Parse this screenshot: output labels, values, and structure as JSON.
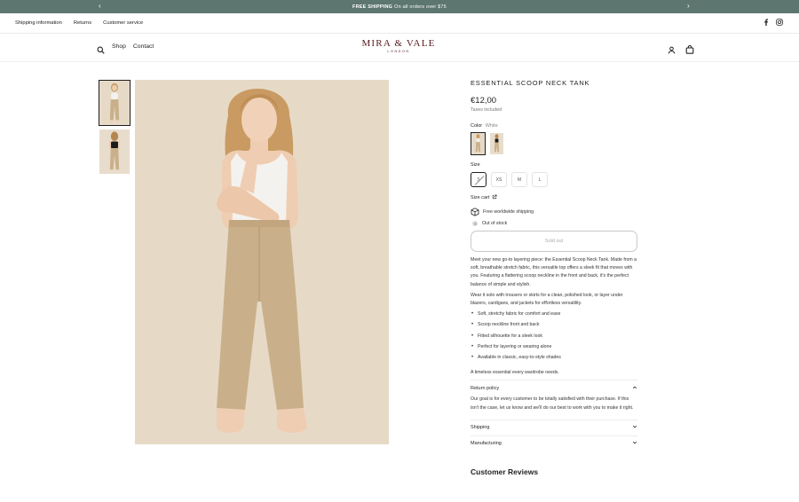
{
  "announcement": {
    "strong": "FREE SHIPPING",
    "text": "On all orders over $75",
    "prev_icon": "chevron-left-icon",
    "next_icon": "chevron-right-icon"
  },
  "utility_links": [
    "Shipping information",
    "Returns",
    "Customer service"
  ],
  "social_icons": [
    "facebook-icon",
    "instagram-icon"
  ],
  "nav": {
    "search_icon": "search-icon",
    "links": [
      "Shop",
      "Contact"
    ],
    "account_icon": "account-icon",
    "cart_icon": "bag-icon"
  },
  "brand": {
    "name": "MIRA & VALE",
    "sub": "LONDON",
    "color": "#5a2024"
  },
  "colors": {
    "announcement_bg": "#5d7670",
    "photo_bg": "#e6dac7",
    "pants": "#c9b08a",
    "top": "#f4f2ee"
  },
  "product": {
    "title": "ESSENTIAL SCOOP NECK TANK",
    "price": "€12,00",
    "tax_note": "Taxes included",
    "color_label": "Color",
    "color_value": "White",
    "size_label": "Size",
    "sizes": [
      "S",
      "XS",
      "M",
      "L"
    ],
    "selected_size": "S",
    "size_chart": "Size cart",
    "shipping_feature": "Free worldwide shipping",
    "stock_status": "Out of stock",
    "button": "Sold out",
    "description_p1": "Meet your new go-to layering piece: the Essential Scoop Neck Tank. Made from a soft, breathable stretch fabric, this versatile top offers a sleek fit that moves with you. Featuring a flattering scoop neckline in the front and back, it's the perfect balance of simple and stylish.",
    "description_p2": "Wear it solo with trousers or skirts for a clean, polished look, or layer under blazers, cardigans, and jackets for effortless versatility.",
    "bullets": [
      "Soft, stretchy fabric for comfort and ease",
      "Scoop neckline front and back",
      "Fitted silhouette for a sleek look",
      "Perfect for layering or wearing alone",
      "Available in classic, easy-to-style shades"
    ],
    "closing": "A timeless essential every wardrobe needs."
  },
  "accordions": [
    {
      "title": "Return policy",
      "open": true,
      "body": "Our goal is for every customer to be totally satisfied with their purchase. If this isn't the case, let us know and we'll do our best to work with you to make it right."
    },
    {
      "title": "Shipping",
      "open": false
    },
    {
      "title": "Manufacturing",
      "open": false
    }
  ],
  "reviews_heading": "Customer Reviews"
}
